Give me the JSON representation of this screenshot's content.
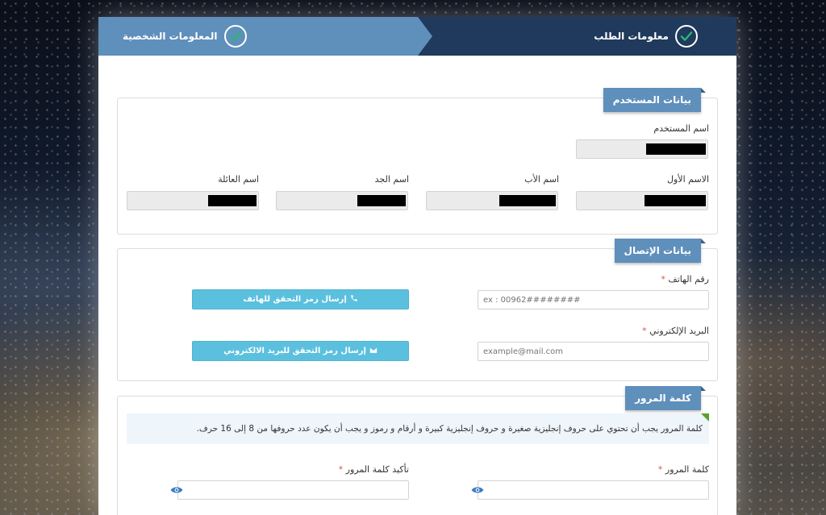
{
  "wizard": {
    "steps": [
      {
        "label": "معلومات الطلب",
        "completed": true
      },
      {
        "label": "المعلومات الشخصية",
        "completed": true
      }
    ]
  },
  "user_section": {
    "title": "بيانات المستخدم",
    "username_label": "اسم المستخدم",
    "first_name_label": "الاسم الأول",
    "father_name_label": "اسم الأب",
    "grandfather_name_label": "اسم الجد",
    "family_name_label": "اسم العائلة"
  },
  "contact_section": {
    "title": "بيانات الإتصال",
    "phone_label": "رقم الهاتف",
    "phone_required": "*",
    "phone_placeholder": "ex : 00962########",
    "phone_button": "إرسال رمز التحقق للهاتف",
    "email_label": "البريد الإلكتروني",
    "email_required": "*",
    "email_placeholder": "example@mail.com",
    "email_button": "إرسال رمز التحقق للبريد الالكتروني"
  },
  "password_section": {
    "title": "كلمة المرور",
    "hint": "كلمة المرور يجب أن تحتوي على حروف إنجليزية صغيرة و حروف إنجليزية كبيرة و أرقام و رموز  و يجب أن يكون عدد حروفها من 8 إلى 16 حرف.",
    "password_label": "كلمة المرور",
    "password_required": "*",
    "confirm_label": "تأكيد كلمة المرور",
    "confirm_required": "*"
  },
  "colors": {
    "wizard_dark": "#1f3a5c",
    "wizard_light": "#5f8fbb",
    "check_green": "#2bb673",
    "button_info": "#5bc0de"
  },
  "icons": {
    "step_check": "check-circle-icon",
    "phone": "phone-icon",
    "email": "envelope-icon",
    "eye": "eye-icon"
  }
}
